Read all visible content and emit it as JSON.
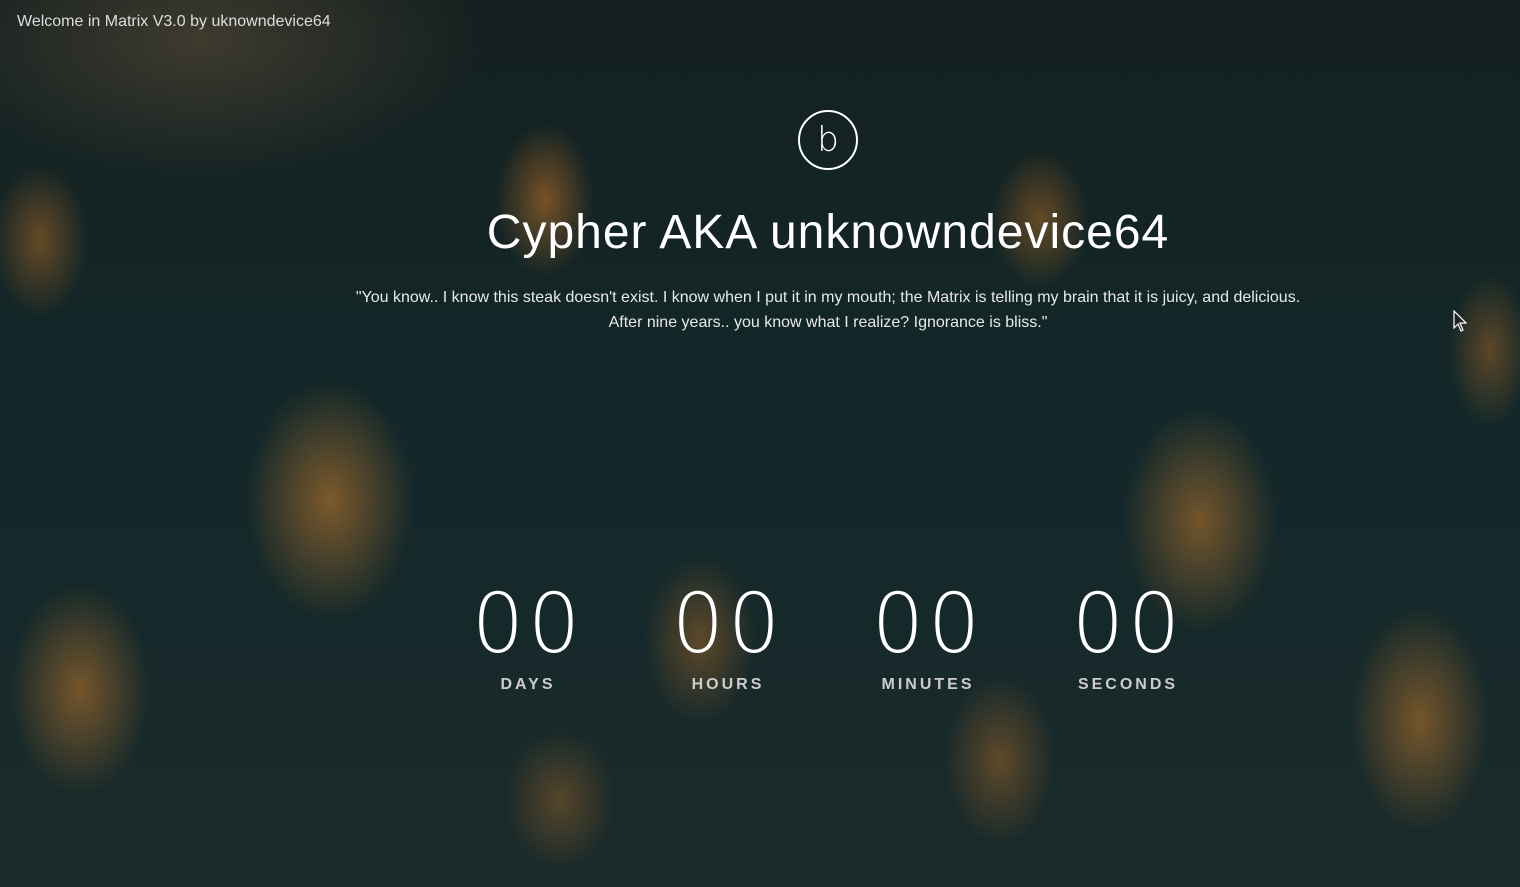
{
  "header": {
    "welcome": "Welcome in Matrix V3.0 by uknowndevice64"
  },
  "logo": {
    "letter": "b"
  },
  "title": "Cypher AKA unknowndevice64",
  "quote": {
    "line1": "\"You know.. I know this steak doesn't exist. I know when I put it in my mouth; the Matrix is telling my brain that it is juicy, and delicious.",
    "line2": "After nine years.. you know what I realize? Ignorance is bliss.\""
  },
  "countdown": [
    {
      "value": "00",
      "label": "DAYS"
    },
    {
      "value": "00",
      "label": "HOURS"
    },
    {
      "value": "00",
      "label": "MINUTES"
    },
    {
      "value": "00",
      "label": "SECONDS"
    }
  ]
}
